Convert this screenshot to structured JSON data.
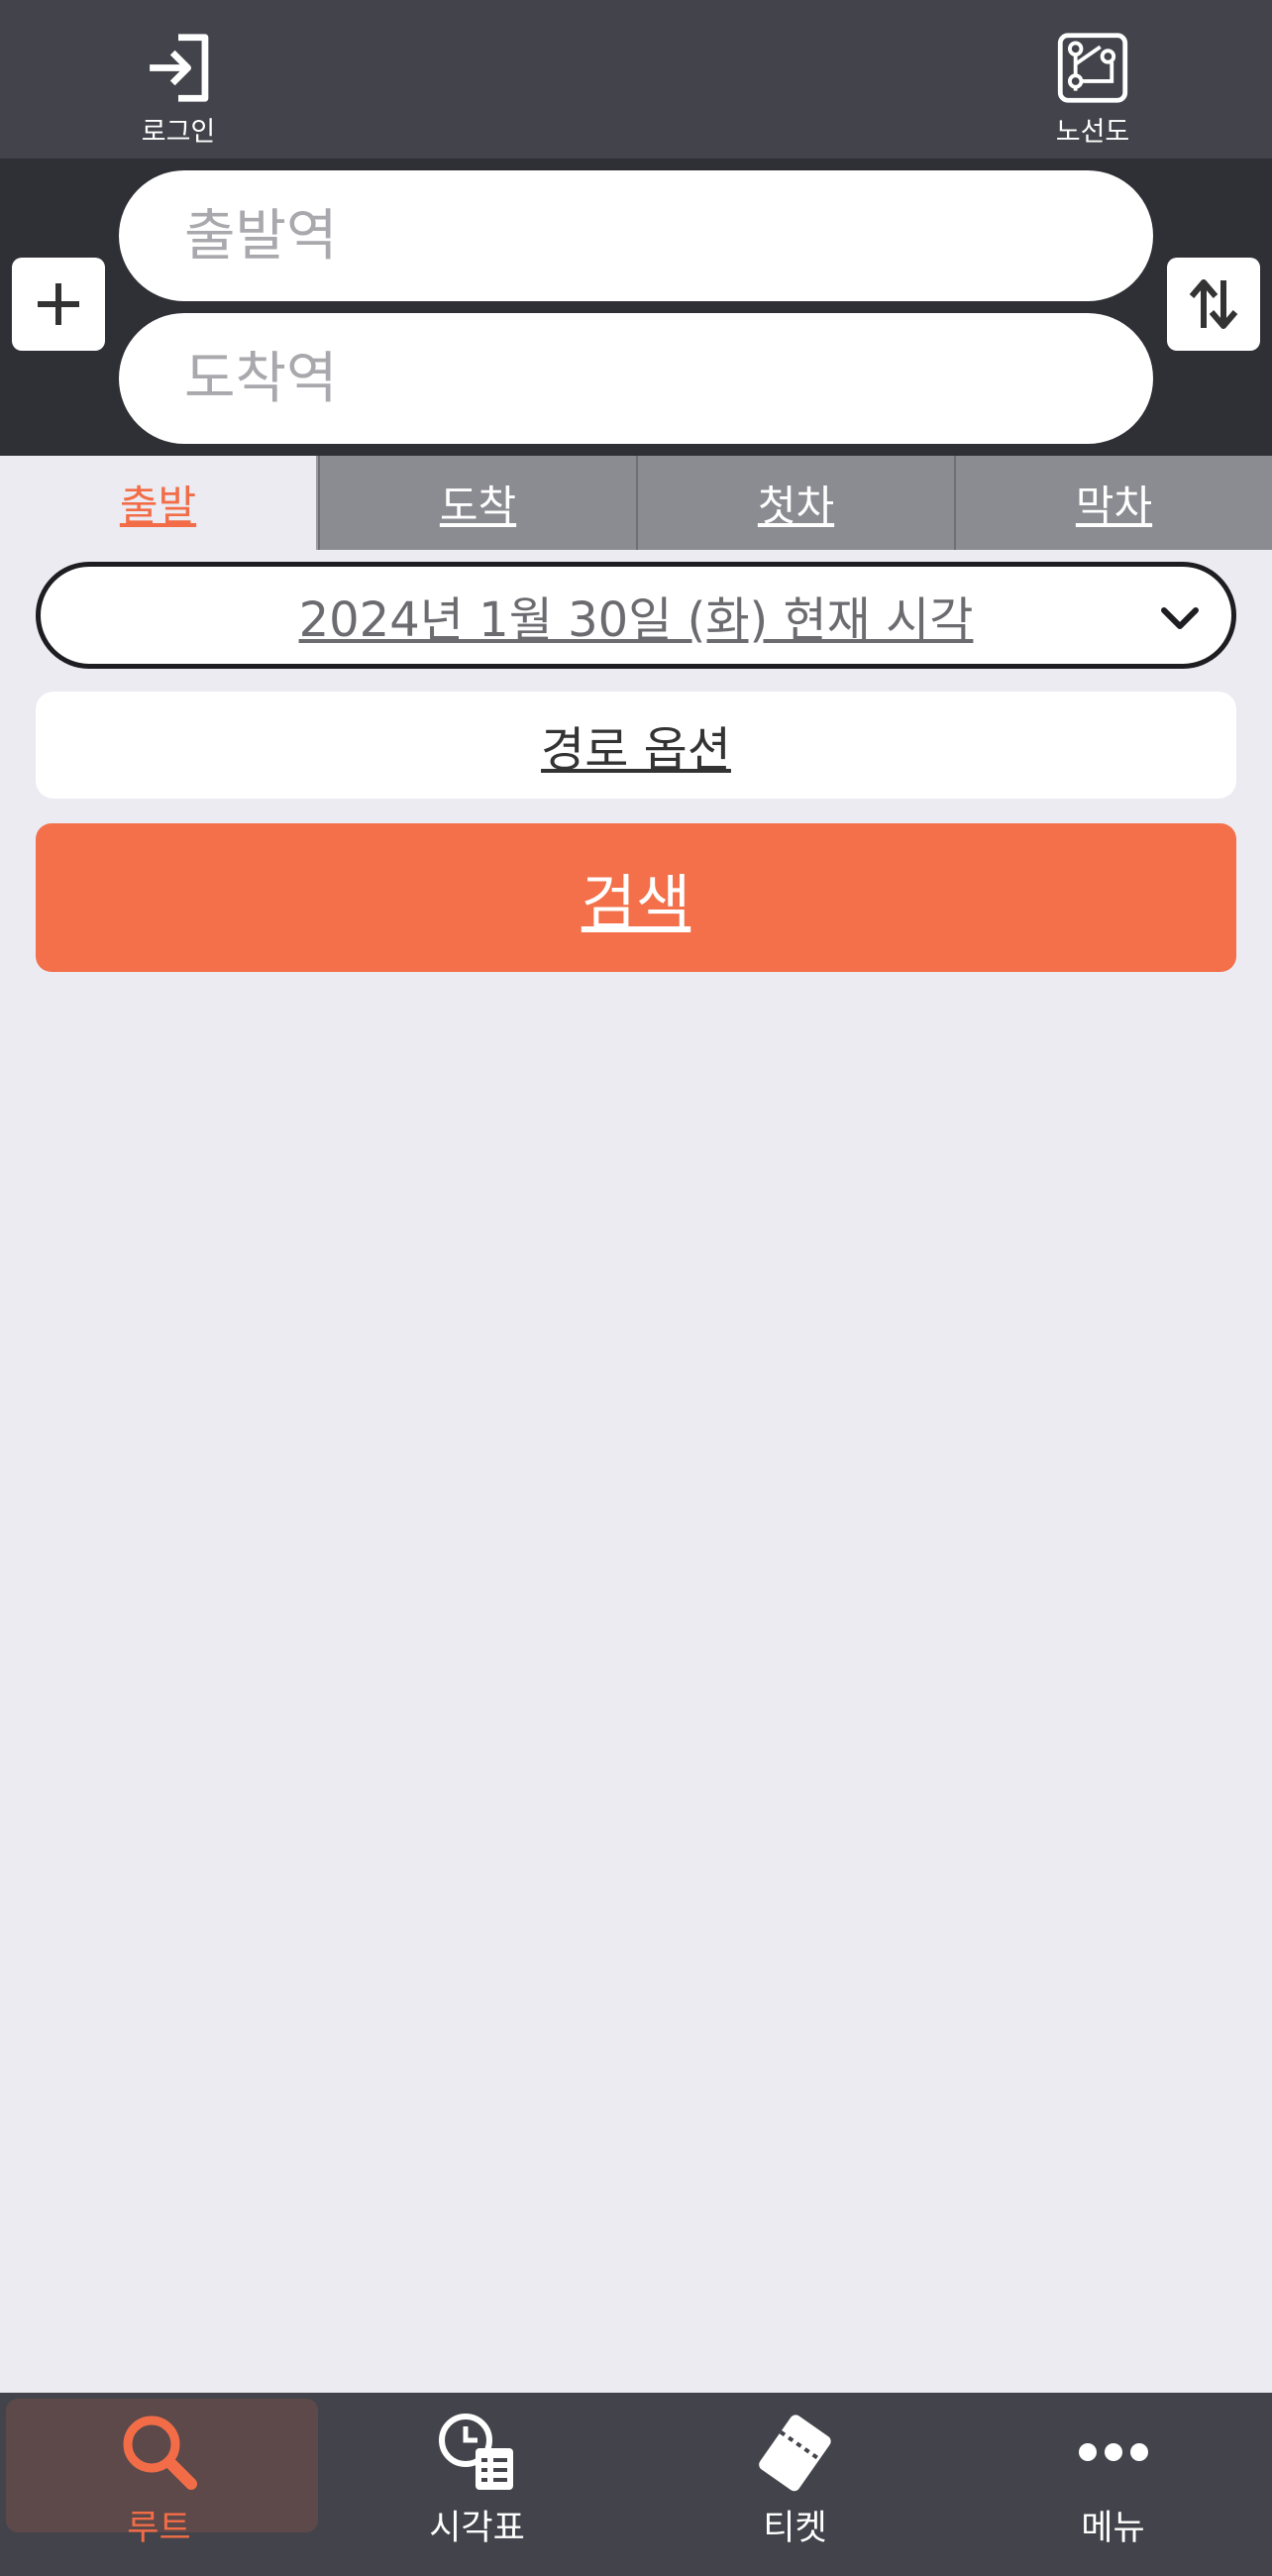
{
  "header": {
    "login_label": "로그인",
    "route_map_label": "노선도",
    "login_icon": "login-arrow-icon",
    "route_map_icon": "route-map-icon"
  },
  "search": {
    "departure_placeholder": "출발역",
    "arrival_placeholder": "도착역",
    "add_icon": "plus-icon",
    "swap_icon": "swap-arrows-icon"
  },
  "tabs": [
    {
      "label": "출발",
      "active": true
    },
    {
      "label": "도착",
      "active": false
    },
    {
      "label": "첫차",
      "active": false
    },
    {
      "label": "막차",
      "active": false
    }
  ],
  "datetime": {
    "label": "2024년 1월 30일 (화) 현재 시각"
  },
  "route_options_label": "경로 옵션",
  "search_button_label": "검색",
  "bottom_nav": [
    {
      "label": "루트",
      "icon": "search-icon",
      "active": true
    },
    {
      "label": "시각표",
      "icon": "timetable-icon",
      "active": false
    },
    {
      "label": "티켓",
      "icon": "ticket-icon",
      "active": false
    },
    {
      "label": "메뉴",
      "icon": "more-dots-icon",
      "active": false
    }
  ],
  "colors": {
    "accent": "#f3704a",
    "header_bg": "#43434b",
    "panel_bg": "#2f2f36",
    "page_bg": "#ecebf1"
  }
}
